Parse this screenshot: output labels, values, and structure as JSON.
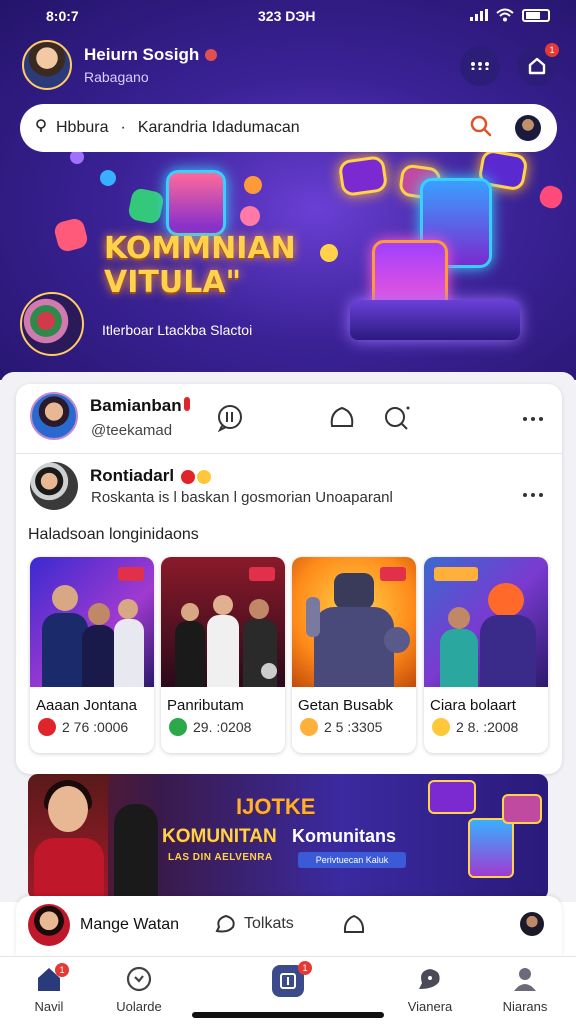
{
  "status_bar": {
    "left_time": "8:0:7",
    "center_time": "323 DЭН"
  },
  "header": {
    "user_name": "Heiurn Sosigh",
    "user_sub": "Rabagano",
    "notification_count": "1"
  },
  "search": {
    "prefix": "Hbbura",
    "text": "Karandria Idadumacan"
  },
  "hero": {
    "title_line1": "KOMMNIAN",
    "title_line2": "VITULA\"",
    "subtitle": "Itlerboar Ltackba Slactoi"
  },
  "post1": {
    "user_name": "Bamianban",
    "handle": "@teekamad"
  },
  "post2": {
    "user_name": "Rontiadarl",
    "description": "Roskanta is l baskan l gosmorian Unoaparanl",
    "caption": "Haladsoan longinidaons",
    "thumbnails": [
      {
        "title": "Aaaan Jontana",
        "count": "2 76 :0006",
        "reaction": "heart-icon"
      },
      {
        "title": "Panributam",
        "count": "29. :0208",
        "reaction": "smile-icon"
      },
      {
        "title": "Getan Busabk",
        "count": "2 5 :3305",
        "reaction": "laugh-icon"
      },
      {
        "title": "Ciara bolaart",
        "count": "2 8. :2008",
        "reaction": "wow-icon"
      }
    ]
  },
  "banner2": {
    "top_text": "IJOTKE",
    "main_text": "KOMUNITAN",
    "side_text": "Komunitans",
    "small_text": "LAS DIN AELVENRA",
    "tag_text": "Perivtuecan Kaluk"
  },
  "post_bar": {
    "name": "Mange Watan",
    "comment_label": "Tolkats"
  },
  "nav": {
    "items": [
      {
        "label": "Navil",
        "badge": "1"
      },
      {
        "label": "Uolarde"
      },
      {
        "label": "",
        "badge": "1"
      },
      {
        "label": "Vianera"
      },
      {
        "label": "Niarans"
      }
    ]
  }
}
